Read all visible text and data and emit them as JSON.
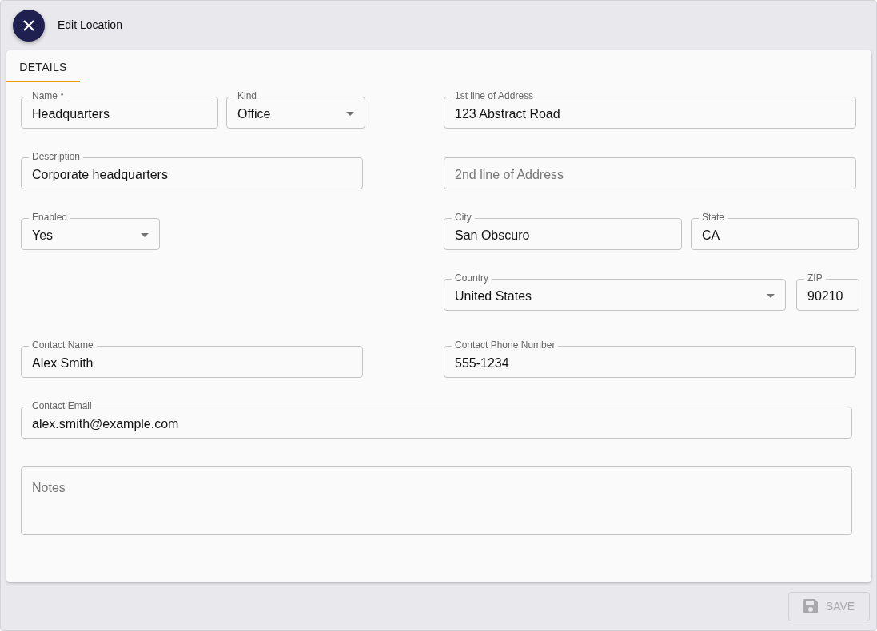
{
  "dialog": {
    "title": "Edit Location"
  },
  "tabs": [
    {
      "label": "DETAILS",
      "selected": true
    }
  ],
  "fields": [
    {
      "kind": "text",
      "label": "Name *",
      "value": "Headquarters"
    },
    {
      "kind": "select",
      "label": "Kind",
      "value": "Office"
    },
    {
      "kind": "text",
      "label": "1st line of Address",
      "value": "123 Abstract Road"
    },
    {
      "kind": "text",
      "label": "Description",
      "value": "Corporate headquarters"
    },
    {
      "kind": "text",
      "placeholder": "2nd line of Address"
    },
    {
      "kind": "select",
      "label": "Enabled",
      "value": "Yes"
    },
    {
      "kind": "text",
      "label": "City",
      "value": "San Obscuro"
    },
    {
      "kind": "text",
      "label": "State",
      "value": "CA"
    },
    {
      "kind": "select",
      "label": "Country",
      "value": "United States"
    },
    {
      "kind": "text",
      "label": "ZIP",
      "value": "90210"
    },
    {
      "kind": "text",
      "label": "Contact Name",
      "value": "Alex Smith"
    },
    {
      "kind": "text",
      "label": "Contact Phone Number",
      "value": "555-1234"
    },
    {
      "kind": "text",
      "label": "Contact Email",
      "value": "alex.smith@example.com"
    },
    {
      "kind": "textarea",
      "placeholder": "Notes"
    }
  ],
  "save_button": {
    "label": "SAVE",
    "disabled": true
  }
}
